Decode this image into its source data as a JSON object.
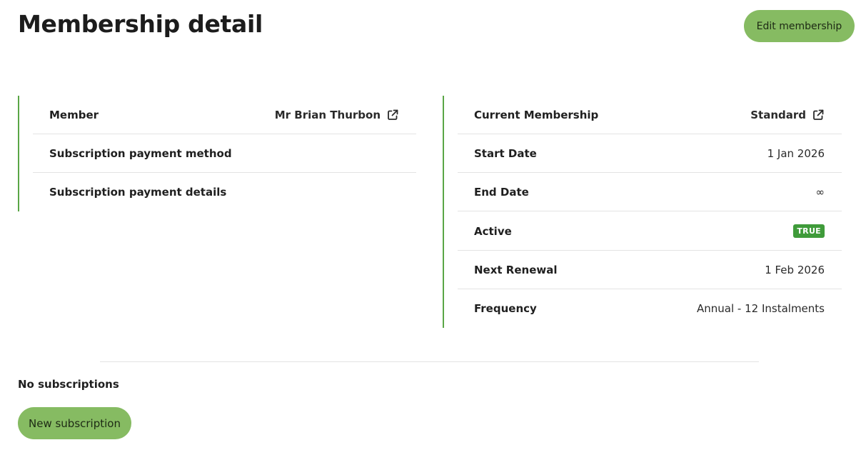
{
  "page": {
    "title": "Membership detail",
    "edit_button": "Edit membership"
  },
  "member_panel": {
    "rows": [
      {
        "label": "Member",
        "value": "Mr Brian Thurbon"
      },
      {
        "label": "Subscription payment method",
        "value": ""
      },
      {
        "label": "Subscription payment details",
        "value": ""
      }
    ]
  },
  "membership_panel": {
    "rows": [
      {
        "label": "Current Membership",
        "value": "Standard"
      },
      {
        "label": "Start Date",
        "value": "1 Jan 2026"
      },
      {
        "label": "End Date",
        "value": "∞"
      },
      {
        "label": "Active",
        "value": "TRUE"
      },
      {
        "label": "Next Renewal",
        "value": "1 Feb 2026"
      },
      {
        "label": "Frequency",
        "value": "Annual - 12 Instalments"
      }
    ]
  },
  "subscriptions": {
    "empty_text": "No subscriptions",
    "new_button": "New subscription"
  },
  "colors": {
    "accent_button": "#86bb62",
    "panel_border": "#5aa646",
    "active_badge": "#3f9b3a"
  },
  "icons": {
    "member_link": "external-link-icon",
    "membership_link": "external-link-icon"
  }
}
